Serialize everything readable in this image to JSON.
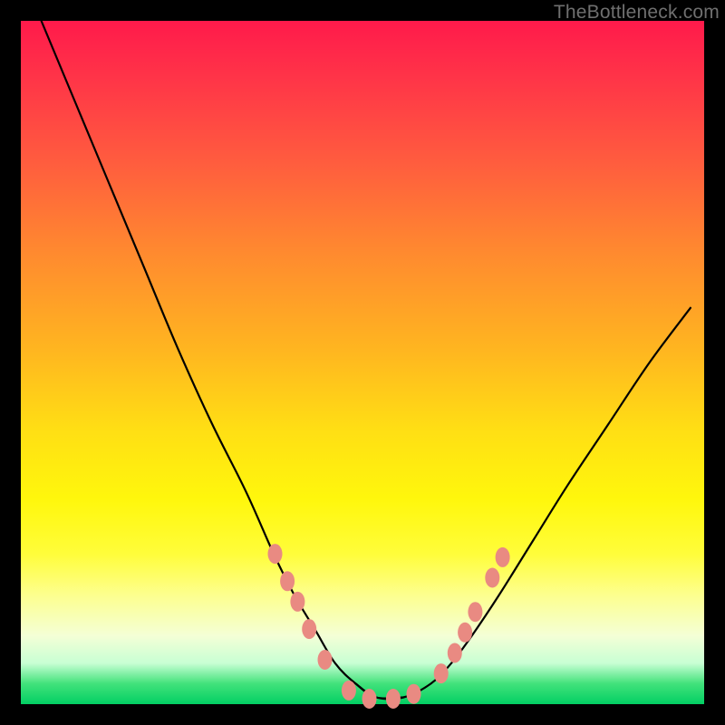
{
  "watermark": "TheBottleneck.com",
  "colors": {
    "background": "#000000",
    "curve": "#000000",
    "dot": "#e98a82"
  },
  "chart_data": {
    "type": "line",
    "title": "",
    "xlabel": "",
    "ylabel": "",
    "xlim": [
      0,
      100
    ],
    "ylim": [
      0,
      100
    ],
    "grid": false,
    "legend": false,
    "series": [
      {
        "name": "bottleneck-curve",
        "x": [
          3,
          8,
          13,
          18,
          23,
          28,
          33,
          37,
          40,
          43,
          46,
          49,
          52,
          56,
          60,
          63,
          66,
          70,
          75,
          80,
          86,
          92,
          98
        ],
        "y": [
          100,
          88,
          76,
          64,
          52,
          41,
          31,
          22,
          16,
          11,
          6,
          3,
          1,
          1,
          3,
          6,
          10,
          16,
          24,
          32,
          41,
          50,
          58
        ]
      }
    ],
    "markers": {
      "name": "highlight-dots",
      "points": [
        {
          "x": 37.2,
          "y": 22.0
        },
        {
          "x": 39.0,
          "y": 18.0
        },
        {
          "x": 40.5,
          "y": 15.0
        },
        {
          "x": 42.2,
          "y": 11.0
        },
        {
          "x": 44.5,
          "y": 6.5
        },
        {
          "x": 48.0,
          "y": 2.0
        },
        {
          "x": 51.0,
          "y": 0.8
        },
        {
          "x": 54.5,
          "y": 0.8
        },
        {
          "x": 57.5,
          "y": 1.5
        },
        {
          "x": 61.5,
          "y": 4.5
        },
        {
          "x": 63.5,
          "y": 7.5
        },
        {
          "x": 65.0,
          "y": 10.5
        },
        {
          "x": 66.5,
          "y": 13.5
        },
        {
          "x": 69.0,
          "y": 18.5
        },
        {
          "x": 70.5,
          "y": 21.5
        }
      ]
    }
  }
}
